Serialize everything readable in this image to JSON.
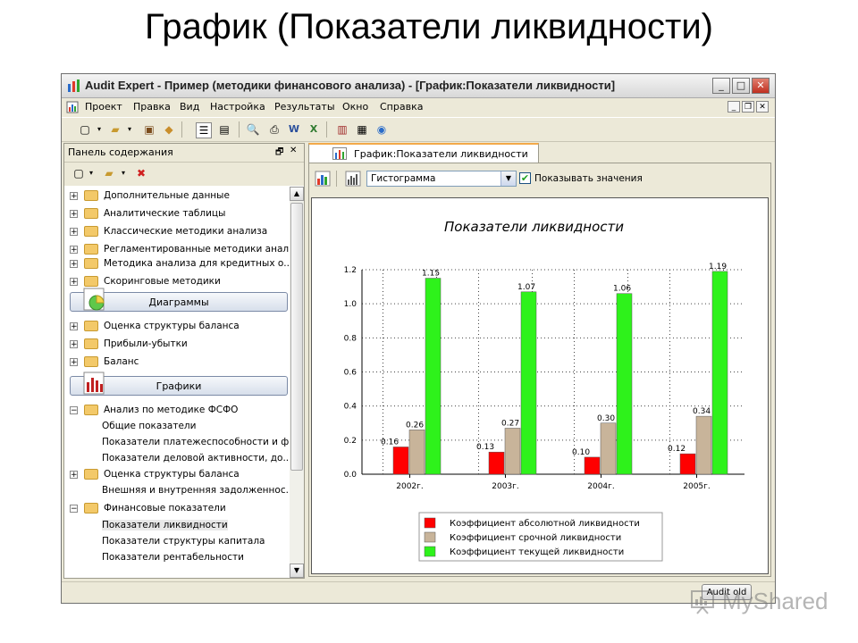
{
  "slide": {
    "title": "График (Показатели ликвидности)"
  },
  "window": {
    "title": "Audit Expert - Пример (методики финансового анализа) - [График:Показатели ликвидности]",
    "controls": {
      "minimize": "_",
      "maximize": "□",
      "close": "✕"
    }
  },
  "menu": {
    "items": [
      {
        "label": "Проект"
      },
      {
        "label": "Правка"
      },
      {
        "label": "Вид"
      },
      {
        "label": "Настройка"
      },
      {
        "label": "Результаты"
      },
      {
        "label": "Окно"
      },
      {
        "label": "Справка"
      }
    ]
  },
  "left_panel": {
    "title": "Панель содержания",
    "pin_glyph": "🗗",
    "close_glyph": "✕",
    "tree_top": [
      {
        "label": "Дополнительные данные"
      },
      {
        "label": "Аналитические таблицы"
      },
      {
        "label": "Классические методики анализа"
      },
      {
        "label": "Регламентированные методики анал..."
      },
      {
        "label": "Методика анализа для кредитных о..."
      },
      {
        "label": "Скоринговые методики"
      }
    ],
    "group_diagrams": "Диаграммы",
    "tree_diagrams": [
      {
        "label": "Оценка структуры баланса"
      },
      {
        "label": "Прибыли-убытки"
      },
      {
        "label": "Баланс"
      }
    ],
    "group_graphs": "Графики",
    "tree_graphs": [
      {
        "label": "Анализ по методике ФСФО"
      },
      {
        "label": "Общие показатели"
      },
      {
        "label": "Показатели платежеспособности и ф..."
      },
      {
        "label": "Показатели деловой активности, до..."
      },
      {
        "label": "Оценка структуры баланса"
      },
      {
        "label": "Внешняя и внутренняя задолженнос..."
      },
      {
        "label": "Финансовые показатели"
      },
      {
        "label": "Показатели ликвидности"
      },
      {
        "label": "Показатели структуры капитала"
      },
      {
        "label": "Показатели рентабельности"
      }
    ]
  },
  "document": {
    "tab_label": "График:Показатели ликвидности",
    "chart_type_select": "Гистограмма",
    "show_values_checked": true,
    "show_values_label": "Показывать значения"
  },
  "status": {
    "button_label": "Audit old"
  },
  "watermark": {
    "text": "MyShared"
  },
  "colors": {
    "absolute": "#ff0000",
    "quick": "#c8b49a",
    "current": "#2ef21b"
  },
  "chart_data": {
    "type": "bar",
    "title": "Показатели ликвидности",
    "categories": [
      "2002г.",
      "2003г.",
      "2004г.",
      "2005г."
    ],
    "series": [
      {
        "name": "Коэффициент абсолютной ликвидности",
        "values": [
          0.16,
          0.13,
          0.1,
          0.12
        ],
        "labels": [
          "0.16",
          "0.13",
          "0.10",
          "0.12"
        ],
        "color": "#ff0000"
      },
      {
        "name": "Коэффициент срочной ликвидности",
        "values": [
          0.26,
          0.27,
          0.3,
          0.34
        ],
        "labels": [
          "0.26",
          "0.27",
          "0.30",
          "0.34"
        ],
        "color": "#c8b49a"
      },
      {
        "name": "Коэффициент текущей ликвидности",
        "values": [
          1.15,
          1.07,
          1.06,
          1.19
        ],
        "labels": [
          "1.15",
          "1.07",
          "1.06",
          "1.19"
        ],
        "color": "#2ef21b"
      }
    ],
    "yticks": [
      "0.0",
      "0.2",
      "0.4",
      "0.6",
      "0.8",
      "1.0",
      "1.2"
    ],
    "ylim": [
      0,
      1.2
    ],
    "grid": true,
    "legend_position": "bottom"
  }
}
